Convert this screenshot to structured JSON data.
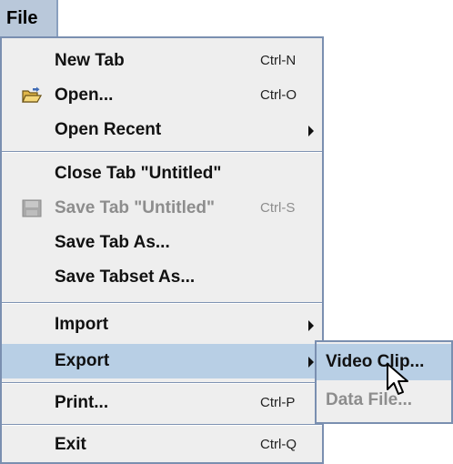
{
  "menubar": {
    "title": "File"
  },
  "menu": {
    "items": [
      {
        "label": "New Tab",
        "accel": "Ctrl-N"
      },
      {
        "label": "Open...",
        "accel": "Ctrl-O",
        "icon": "folder-open-icon"
      },
      {
        "label": "Open Recent",
        "submenu": true
      },
      {
        "label": "Close Tab \"Untitled\""
      },
      {
        "label": "Save Tab \"Untitled\"",
        "accel": "Ctrl-S",
        "icon": "floppy-disk-icon",
        "disabled": true
      },
      {
        "label": "Save Tab As..."
      },
      {
        "label": "Save Tabset As..."
      },
      {
        "label": "Import",
        "submenu": true
      },
      {
        "label": "Export",
        "submenu": true,
        "selected": true
      },
      {
        "label": "Print...",
        "accel": "Ctrl-P"
      },
      {
        "label": "Exit",
        "accel": "Ctrl-Q"
      }
    ]
  },
  "export_submenu": {
    "items": [
      {
        "label": "Video Clip...",
        "selected": true
      },
      {
        "label": "Data File...",
        "disabled": true
      }
    ]
  },
  "colors": {
    "menu_bg": "#eeeeee",
    "selection": "#b8cfe5",
    "border": "#7a8fb0",
    "disabled_text": "#8d8d8d"
  }
}
